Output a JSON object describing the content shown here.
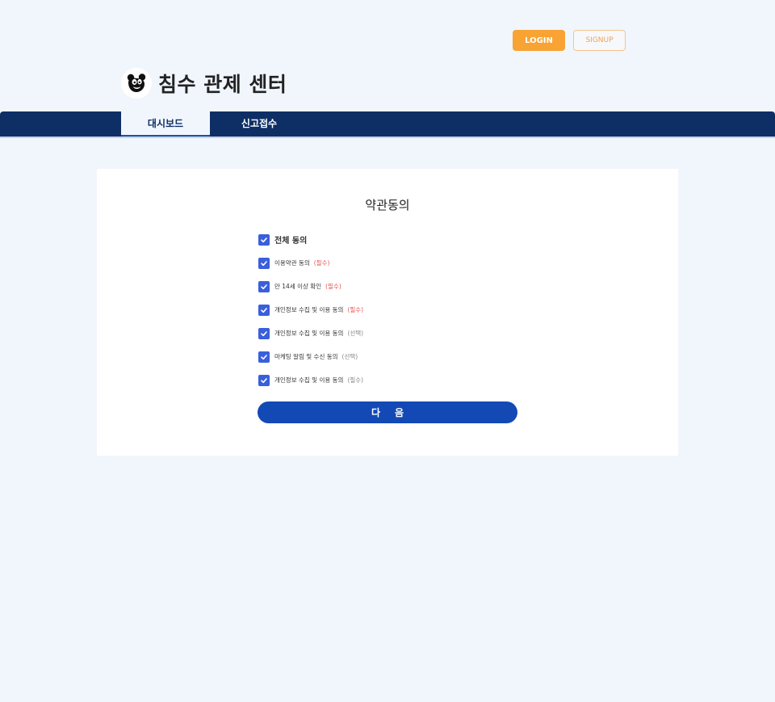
{
  "header": {
    "login_label": "LOGIN",
    "signup_label": "SIGNUP",
    "brand_title": "침수 관제 센터",
    "logo_icon": "panda-logo-icon"
  },
  "nav": {
    "tabs": [
      {
        "label": "대시보드",
        "active": true
      },
      {
        "label": "신고접수",
        "active": false
      }
    ]
  },
  "terms": {
    "title": "약관동의",
    "agree_all_label": "전체 동의",
    "items": [
      {
        "label": "이용약관 동의",
        "tag": "(필수)",
        "checked": true
      },
      {
        "label": "만 14세 이상 확인",
        "tag": "(필수)",
        "checked": true
      },
      {
        "label": "개인정보 수집 및 이용 동의",
        "tag": "(필수)",
        "checked": true
      },
      {
        "label": "개인정보 수집 및 이용 동의",
        "tag": "(선택)",
        "checked": true
      },
      {
        "label": "마케팅 알림 및 수신 동의",
        "tag": "(선택)",
        "checked": true
      },
      {
        "label": "개인정보 수집 및 이용 동의",
        "tag": "(필수)",
        "checked": true
      }
    ],
    "next_label": "다음"
  },
  "colors": {
    "navbar": "#0e2f66",
    "login": "#f8a334",
    "checkbox": "#3a5fdc",
    "next_button": "#1349b5",
    "required": "#e55353",
    "optional": "#888888"
  }
}
